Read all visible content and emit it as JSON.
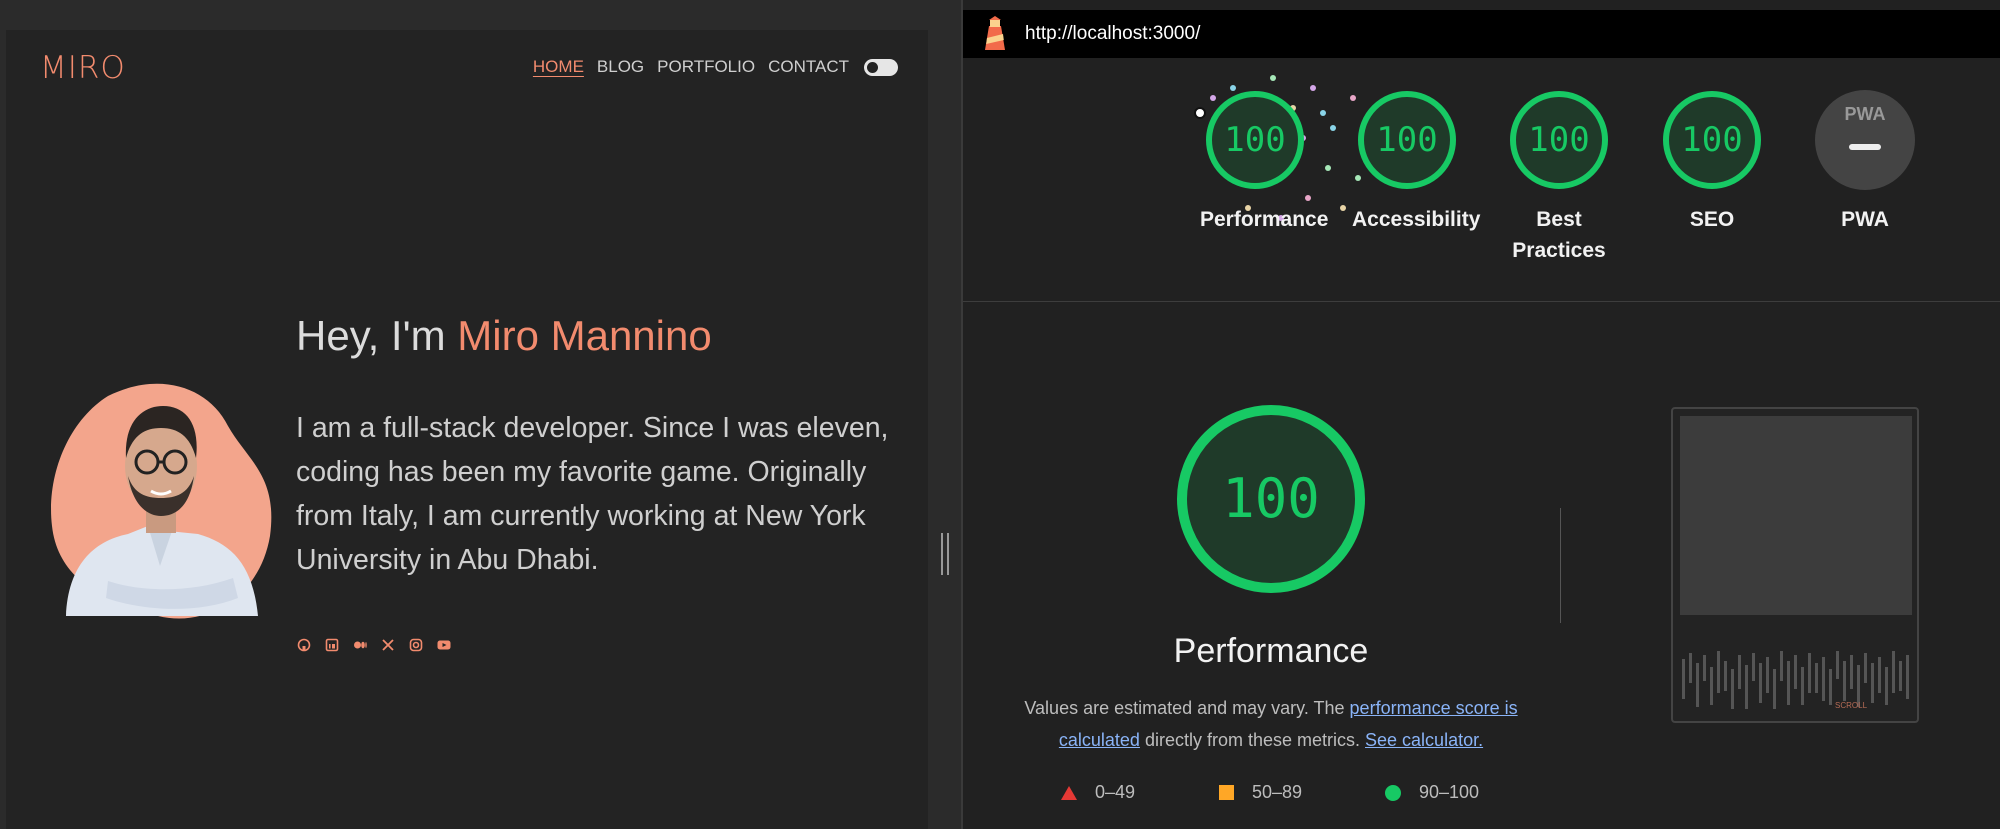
{
  "site": {
    "logo": "MIRO",
    "nav": [
      "HOME",
      "BLOG",
      "PORTFOLIO",
      "CONTACT"
    ],
    "hero_greeting": "Hey, I'm ",
    "hero_name": "Miro Mannino",
    "hero_text": "I am a full-stack developer. Since I was eleven, coding has been my favorite game. Originally from Italy, I am currently working at New York University in Abu Dhabi.",
    "socials": [
      "github-icon",
      "linkedin-icon",
      "medium-icon",
      "x-icon",
      "instagram-icon",
      "youtube-icon"
    ],
    "accent_color": "#f28b6e"
  },
  "lighthouse": {
    "url": "http://localhost:3000/",
    "scores": [
      {
        "label": "Performance",
        "value": "100"
      },
      {
        "label": "Accessibility",
        "value": "100"
      },
      {
        "label": "Best Practices",
        "value": "100"
      },
      {
        "label": "SEO",
        "value": "100"
      }
    ],
    "pwa": {
      "badge": "PWA",
      "label": "PWA"
    },
    "main_score": "100",
    "main_title": "Performance",
    "desc_prefix": "Values are estimated and may vary. The ",
    "desc_link1": "performance score is calculated",
    "desc_middle": " directly from these metrics. ",
    "desc_link2": "See calculator.",
    "legend": [
      "0–49",
      "50–89",
      "90–100"
    ],
    "thumbnail_scroll": "SCROLL",
    "pass_color": "#17c964"
  }
}
